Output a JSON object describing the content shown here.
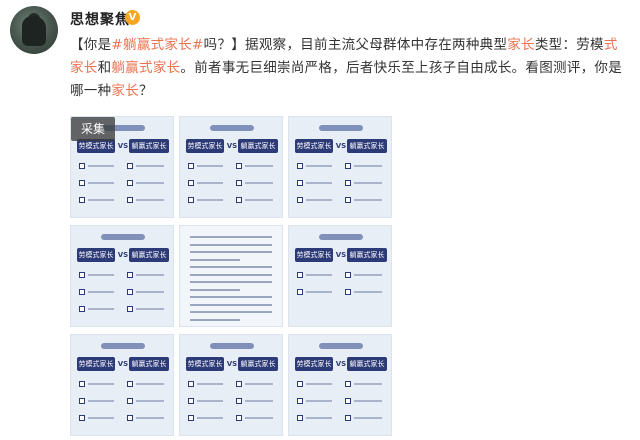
{
  "post": {
    "username": "思想聚焦",
    "verified_badge": "V",
    "text_parts": [
      {
        "text": "【你是",
        "hl": false
      },
      {
        "text": "#躺赢式家长#",
        "hl": true
      },
      {
        "text": "吗？】据观察，目前主流父母群体中存在两种典型",
        "hl": false
      },
      {
        "text": "家长",
        "hl": true
      },
      {
        "text": "类型：劳模",
        "hl": false
      },
      {
        "text": "式家长",
        "hl": true
      },
      {
        "text": "和",
        "hl": false
      },
      {
        "text": "躺赢式家长",
        "hl": true
      },
      {
        "text": "。前者事无巨细崇尚严格，后者快乐至上孩子自由成长。看图测评，你是哪一种",
        "hl": false
      },
      {
        "text": "家长",
        "hl": true
      },
      {
        "text": "？",
        "hl": false
      }
    ]
  },
  "images": {
    "collect_button": "采集",
    "tile_left_label": "劳模式家长",
    "tile_vs": "VS",
    "tile_right_label": "躺赢式家长"
  }
}
